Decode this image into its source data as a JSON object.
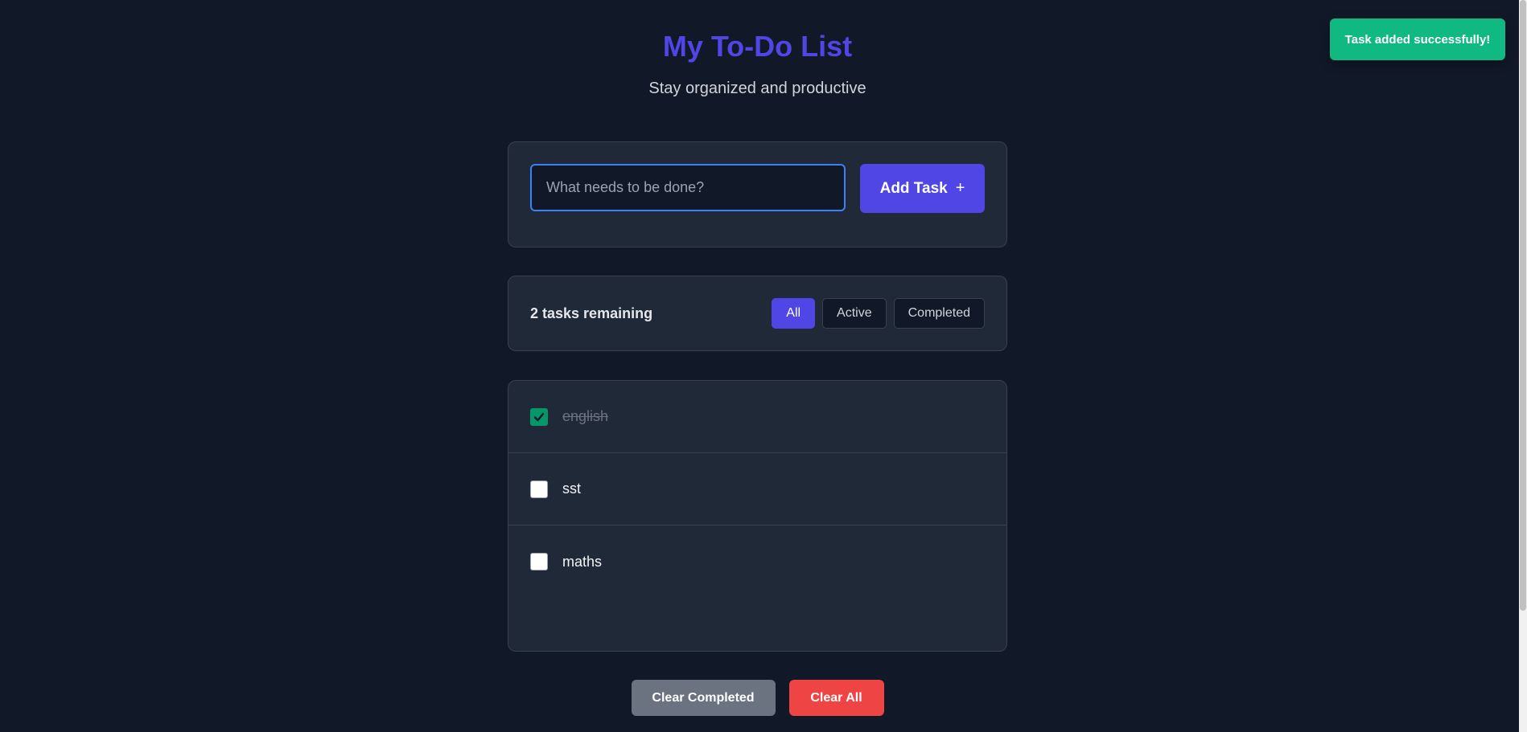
{
  "header": {
    "title": "My To-Do List",
    "subtitle": "Stay organized and productive"
  },
  "toast": {
    "message": "Task added successfully!",
    "color": "#10b981"
  },
  "input": {
    "placeholder": "What needs to be done?",
    "value": ""
  },
  "add_button": {
    "label": "Add Task",
    "icon": "plus-icon",
    "icon_glyph": "+"
  },
  "status": {
    "remaining": "2 tasks remaining"
  },
  "filters": [
    {
      "label": "All",
      "active": true
    },
    {
      "label": "Active",
      "active": false
    },
    {
      "label": "Completed",
      "active": false
    }
  ],
  "tasks": [
    {
      "text": "english",
      "completed": true
    },
    {
      "text": "sst",
      "completed": false
    },
    {
      "text": "maths",
      "completed": false
    }
  ],
  "actions": {
    "clear_completed": "Clear Completed",
    "clear_all": "Clear All"
  },
  "colors": {
    "accent": "#4f46e5",
    "background": "#111827",
    "card": "#1f2937",
    "success": "#10b981",
    "danger": "#ef4444",
    "neutral": "#6b7280"
  }
}
